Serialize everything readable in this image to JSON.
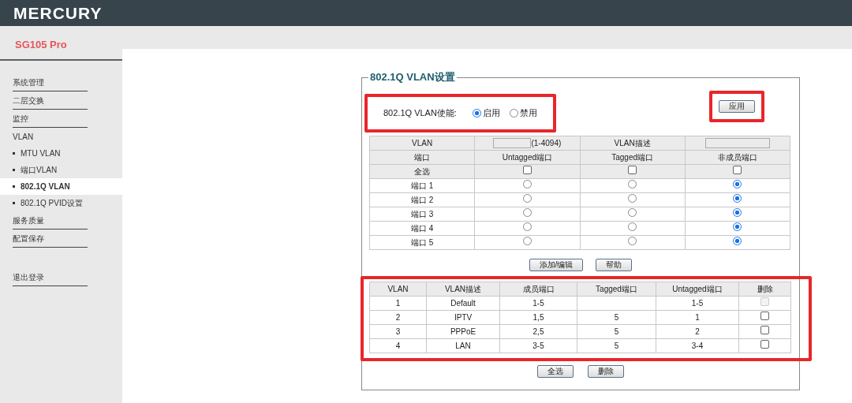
{
  "brand": "MERCURY",
  "model": "SG105 Pro",
  "sidebar": {
    "items": [
      {
        "label": "系统管理",
        "kind": "link",
        "selected": false
      },
      {
        "label": "二层交换",
        "kind": "link",
        "selected": false
      },
      {
        "label": "监控",
        "kind": "link",
        "selected": false
      },
      {
        "label": "VLAN",
        "kind": "group",
        "selected": false,
        "children": [
          {
            "label": "MTU VLAN",
            "selected": false
          },
          {
            "label": "端口VLAN",
            "selected": false
          },
          {
            "label": "802.1Q VLAN",
            "selected": true
          },
          {
            "label": "802.1Q PVID设置",
            "selected": false
          }
        ]
      },
      {
        "label": "服务质量",
        "kind": "link",
        "selected": false
      },
      {
        "label": "配置保存",
        "kind": "link",
        "selected": false
      },
      {
        "label": "退出登录",
        "kind": "logout",
        "selected": false
      }
    ]
  },
  "panel": {
    "title": "802.1Q VLAN设置",
    "enable": {
      "label": "802.1Q VLAN使能:",
      "highlighted": true,
      "options": [
        {
          "label": "启用",
          "selected": true
        },
        {
          "label": "禁用",
          "selected": false
        }
      ]
    },
    "apply": {
      "label": "应用",
      "highlighted": true
    },
    "form": {
      "vlan_label": "VLAN",
      "vlan_hint": "(1-4094)",
      "desc_label": "VLAN描述",
      "headers": [
        "端口",
        "Untagged端口",
        "Tagged端口",
        "非成员端口"
      ],
      "select_all": {
        "label": "全选",
        "boxes": [
          {
            "checked": false
          },
          {
            "checked": false
          },
          {
            "checked": false
          }
        ]
      },
      "ports": [
        {
          "label": "端口 1",
          "options": [
            {
              "selected": false
            },
            {
              "selected": false
            },
            {
              "selected": true
            }
          ]
        },
        {
          "label": "端口 2",
          "options": [
            {
              "selected": false
            },
            {
              "selected": false
            },
            {
              "selected": true
            }
          ]
        },
        {
          "label": "端口 3",
          "options": [
            {
              "selected": false
            },
            {
              "selected": false
            },
            {
              "selected": true
            }
          ]
        },
        {
          "label": "端口 4",
          "options": [
            {
              "selected": false
            },
            {
              "selected": false
            },
            {
              "selected": true
            }
          ]
        },
        {
          "label": "端口 5",
          "options": [
            {
              "selected": false
            },
            {
              "selected": false
            },
            {
              "selected": true
            }
          ]
        }
      ]
    },
    "form_buttons": [
      "添加/编辑",
      "帮助"
    ],
    "table": {
      "highlighted": true,
      "columns": [
        "VLAN",
        "VLAN描述",
        "成员端口",
        "Tagged端口",
        "Untagged端口",
        "删除"
      ],
      "rows": [
        {
          "cells": [
            "1",
            "Default",
            "1-5",
            "",
            "1-5"
          ],
          "checked": false,
          "disabled": true
        },
        {
          "cells": [
            "2",
            "IPTV",
            "1,5",
            "5",
            "1"
          ],
          "checked": false,
          "disabled": false
        },
        {
          "cells": [
            "3",
            "PPPoE",
            "2,5",
            "5",
            "2"
          ],
          "checked": false,
          "disabled": false
        },
        {
          "cells": [
            "4",
            "LAN",
            "3-5",
            "5",
            "3-4"
          ],
          "checked": false,
          "disabled": false
        }
      ]
    },
    "table_buttons": [
      "全选",
      "删除"
    ]
  }
}
